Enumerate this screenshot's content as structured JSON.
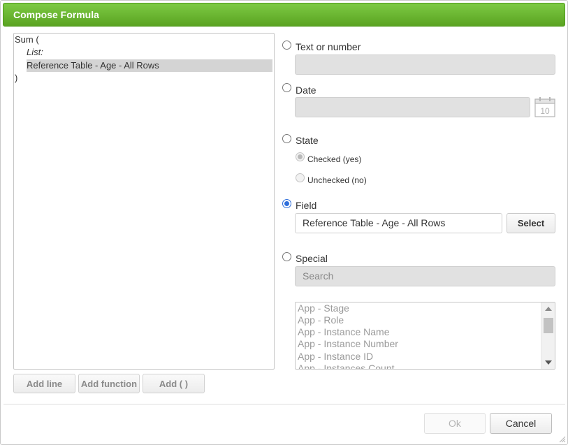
{
  "dialog": {
    "title": "Compose Formula"
  },
  "editor": {
    "lines": [
      "Sum (",
      "List:",
      "Reference Table - Age - All Rows",
      ")"
    ]
  },
  "editor_buttons": {
    "add_line": "Add line",
    "add_function": "Add function",
    "add_parens": "Add ( )"
  },
  "options": {
    "text_or_number": {
      "label": "Text or number",
      "value": ""
    },
    "date": {
      "label": "Date",
      "value": "",
      "calendar_day": "10"
    },
    "state": {
      "label": "State",
      "checked_label": "Checked (yes)",
      "unchecked_label": "Unchecked (no)"
    },
    "field": {
      "label": "Field",
      "value": "Reference Table - Age - All Rows",
      "select_label": "Select"
    },
    "special": {
      "label": "Special",
      "search_placeholder": "Search",
      "items": [
        "App - Stage",
        "App - Role",
        "App - Instance Name",
        "App - Instance Number",
        "App - Instance ID",
        "App - Instances Count"
      ]
    }
  },
  "footer": {
    "ok_label": "Ok",
    "cancel_label": "Cancel"
  },
  "colors": {
    "titlebar": "#6ab832",
    "radio_selected": "#2f6fdb",
    "highlight": "#d4d4d4"
  }
}
